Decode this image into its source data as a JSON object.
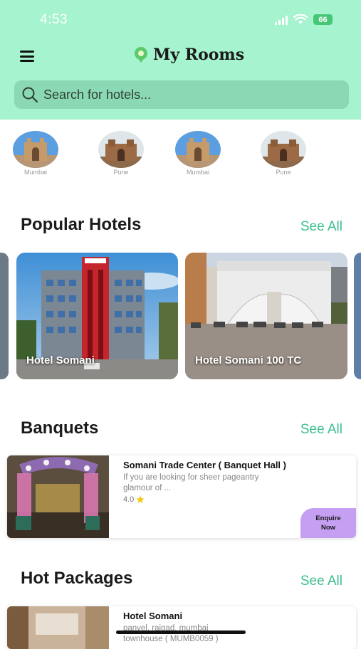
{
  "status_bar": {
    "time": "4:53",
    "battery": "66"
  },
  "header": {
    "title": "My Rooms"
  },
  "search": {
    "placeholder": "Search for hotels..."
  },
  "cities": [
    {
      "label": "Mumbai"
    },
    {
      "label": "Pune"
    },
    {
      "label": "Mumbai"
    },
    {
      "label": "Pune"
    }
  ],
  "popular": {
    "title": "Popular Hotels",
    "see_all": "See All",
    "hotels": [
      {
        "name": "Hotel Somani"
      },
      {
        "name": "Hotel Somani 100 TC"
      }
    ]
  },
  "banquets": {
    "title": "Banquets",
    "see_all": "See All",
    "item": {
      "name": "Somani Trade Center ( Banquet Hall )",
      "desc_line1": "If you are looking for sheer pageantry",
      "desc_line2": "glamour of ...",
      "rating": "4.0",
      "enquire_line1": "Enquire",
      "enquire_line2": "Now"
    }
  },
  "packages": {
    "title": "Hot Packages",
    "see_all": "See All",
    "item": {
      "name": "Hotel Somani",
      "desc_line1": "panvel, raigad, mumbai",
      "desc_line2": "townhouse ( MUMB0059 )"
    }
  },
  "colors": {
    "header_bg": "#a6f3cf",
    "search_bg": "#8ad9b4",
    "accent": "#3bbf8d",
    "enquire_bg": "#c59ff1"
  },
  "icons": [
    "menu-icon",
    "location-pin-icon",
    "search-icon",
    "star-icon",
    "signal-icon",
    "wifi-icon",
    "battery-icon"
  ]
}
